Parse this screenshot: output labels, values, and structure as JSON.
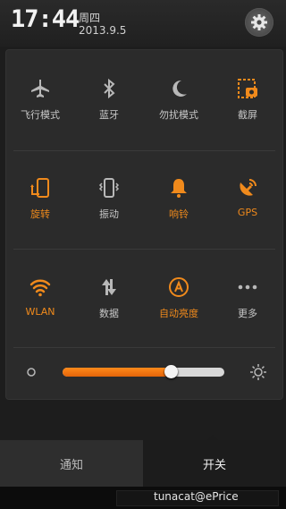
{
  "status": {
    "time": "17:44",
    "weekday": "周四",
    "date": "2013.9.5"
  },
  "toggles": [
    {
      "label": "飞行模式",
      "icon": "airplane-icon",
      "on": false
    },
    {
      "label": "蓝牙",
      "icon": "bluetooth-icon",
      "on": false
    },
    {
      "label": "勿扰模式",
      "icon": "moon-icon",
      "on": false
    },
    {
      "label": "截屏",
      "icon": "screenshot-icon",
      "on": true
    },
    {
      "label": "旋转",
      "icon": "rotate-icon",
      "on": true
    },
    {
      "label": "振动",
      "icon": "vibrate-icon",
      "on": false
    },
    {
      "label": "响铃",
      "icon": "bell-icon",
      "on": true
    },
    {
      "label": "GPS",
      "icon": "gps-icon",
      "on": true
    },
    {
      "label": "WLAN",
      "icon": "wifi-icon",
      "on": true
    },
    {
      "label": "数据",
      "icon": "data-icon",
      "on": false
    },
    {
      "label": "自动亮度",
      "icon": "auto-brightness-icon",
      "on": true
    },
    {
      "label": "更多",
      "icon": "more-icon",
      "on": false
    }
  ],
  "brightness": {
    "level": 0.67
  },
  "tabs": {
    "notifications": "通知",
    "switches": "开关"
  },
  "watermark": "tunacat@ePrice",
  "colors": {
    "accent": "#f08a1c",
    "icon_gray": "#b8b8b8"
  }
}
